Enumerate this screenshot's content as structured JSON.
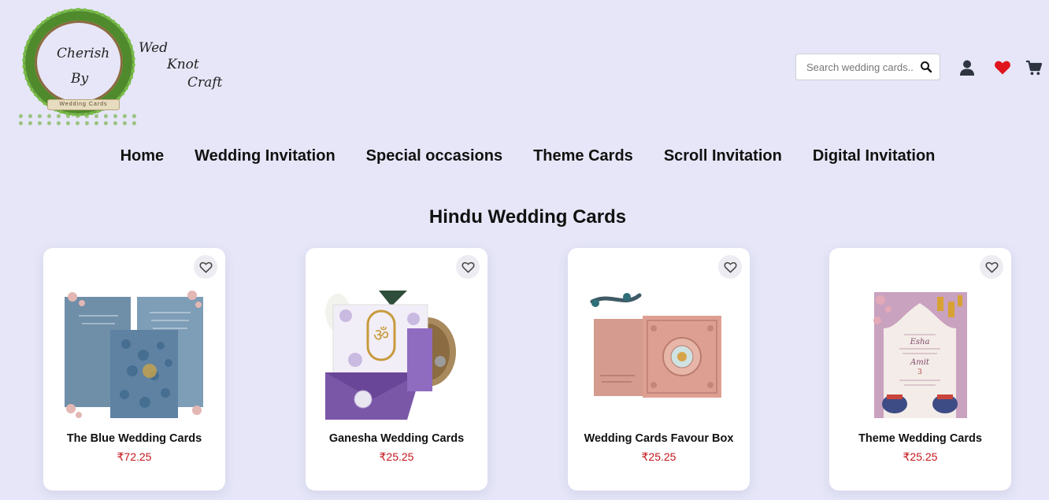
{
  "logo": {
    "wreath_text_1": "Cherish",
    "wreath_text_2": "By",
    "banner": "Wedding Cards",
    "side_1": "Wed",
    "side_2": "Knot",
    "side_3": "Craft"
  },
  "search": {
    "placeholder": "Search wedding cards..."
  },
  "icons": {
    "search": "search-icon",
    "user": "user-icon",
    "wishlist": "heart-icon",
    "cart": "cart-icon"
  },
  "colors": {
    "background": "#e6e6f8",
    "price": "#c4161c",
    "heart": "#e0141c"
  },
  "nav": {
    "items": [
      {
        "label": "Home"
      },
      {
        "label": "Wedding Invitation"
      },
      {
        "label": "Special occasions"
      },
      {
        "label": "Theme Cards"
      },
      {
        "label": "Scroll Invitation"
      },
      {
        "label": "Digital Invitation"
      }
    ]
  },
  "section": {
    "title": "Hindu Wedding Cards",
    "products": [
      {
        "name": "The Blue Wedding Cards",
        "price": "₹72.25"
      },
      {
        "name": "Ganesha Wedding Cards",
        "price": "₹25.25"
      },
      {
        "name": "Wedding Cards Favour Box",
        "price": "₹25.25"
      },
      {
        "name": "Theme Wedding Cards",
        "price": "₹25.25"
      }
    ]
  }
}
